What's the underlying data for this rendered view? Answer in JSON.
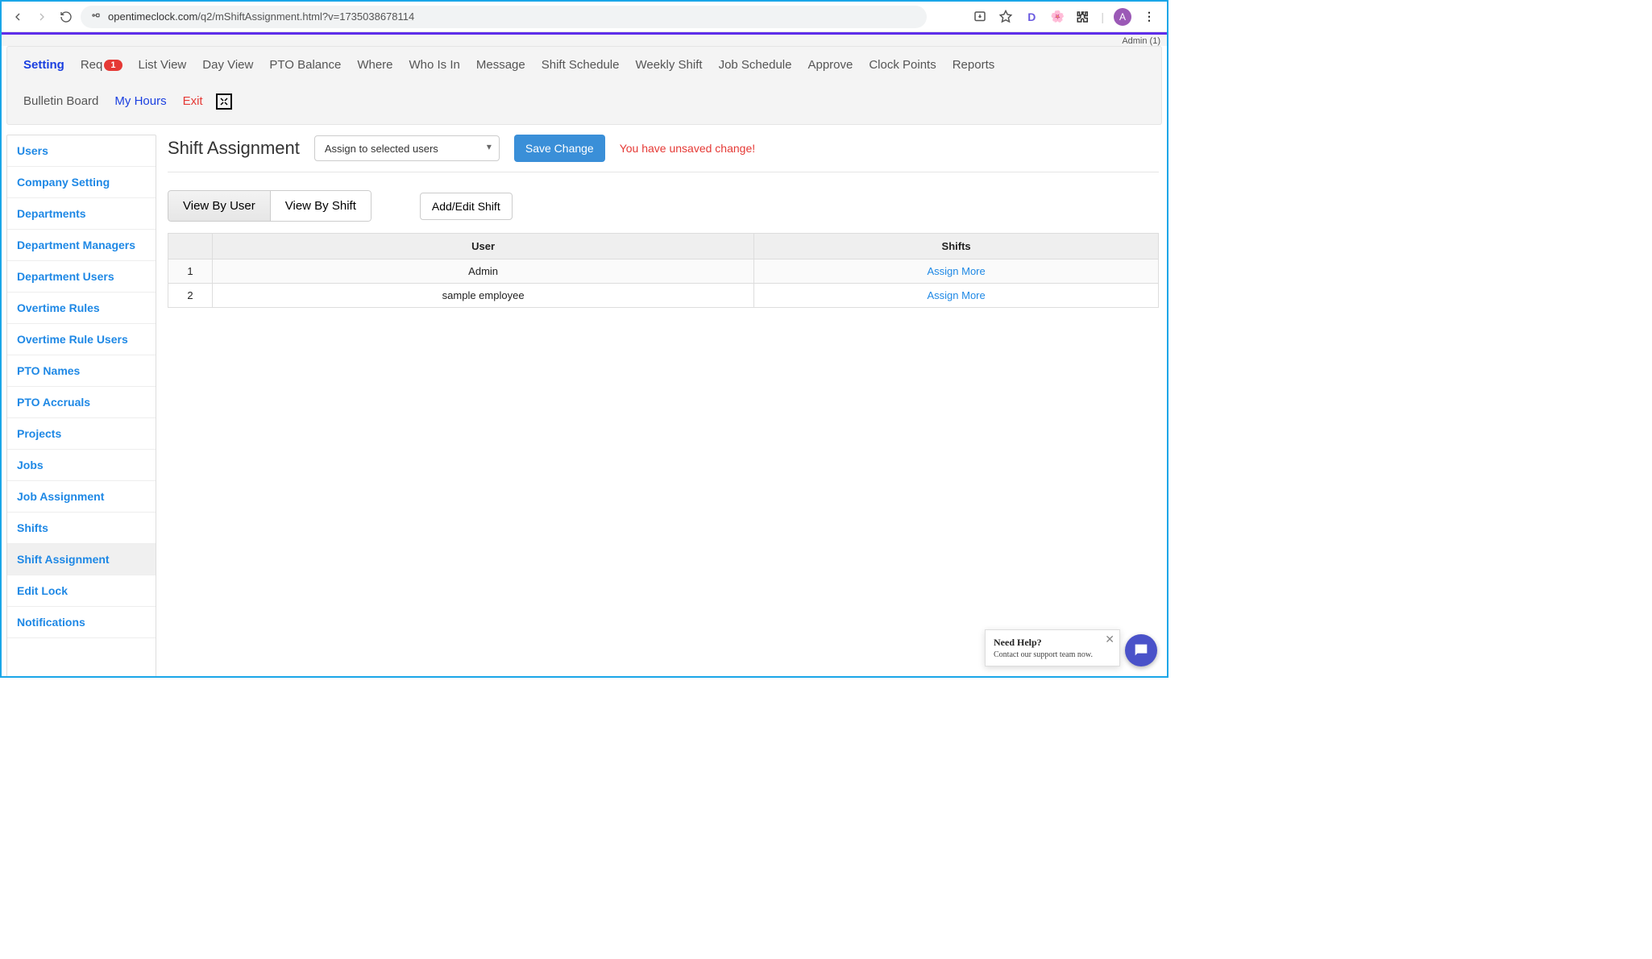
{
  "browser": {
    "url_host": "opentimeclock.com",
    "url_path": "/q2/mShiftAssignment.html?v=1735038678114",
    "avatar_letter": "A",
    "ext_d": "D"
  },
  "admin_label": "Admin (1)",
  "topnav": {
    "setting": "Setting",
    "req": "Req",
    "req_badge": "1",
    "list_view": "List View",
    "day_view": "Day View",
    "pto_balance": "PTO Balance",
    "where": "Where",
    "who_is_in": "Who Is In",
    "message": "Message",
    "shift_schedule": "Shift Schedule",
    "weekly_shift": "Weekly Shift",
    "job_schedule": "Job Schedule",
    "approve": "Approve",
    "clock_points": "Clock Points",
    "reports": "Reports",
    "bulletin_board": "Bulletin Board",
    "my_hours": "My Hours",
    "exit": "Exit"
  },
  "sidebar": {
    "items": [
      "Users",
      "Company Setting",
      "Departments",
      "Department Managers",
      "Department Users",
      "Overtime Rules",
      "Overtime Rule Users",
      "PTO Names",
      "PTO Accruals",
      "Projects",
      "Jobs",
      "Job Assignment",
      "Shifts",
      "Shift Assignment",
      "Edit Lock",
      "Notifications"
    ],
    "selected_index": 13
  },
  "header": {
    "title": "Shift Assignment",
    "dropdown_selected": "Assign to selected users",
    "save_btn": "Save Change",
    "unsaved_msg": "You have unsaved change!"
  },
  "controls": {
    "view_by_user": "View By User",
    "view_by_shift": "View By Shift",
    "add_edit": "Add/Edit Shift"
  },
  "table": {
    "col_user": "User",
    "col_shifts": "Shifts",
    "assign_more_label": "Assign More",
    "rows": [
      {
        "n": "1",
        "user": "Admin"
      },
      {
        "n": "2",
        "user": "sample employee"
      }
    ]
  },
  "help": {
    "title": "Need Help?",
    "subtitle": "Contact our support team now."
  }
}
